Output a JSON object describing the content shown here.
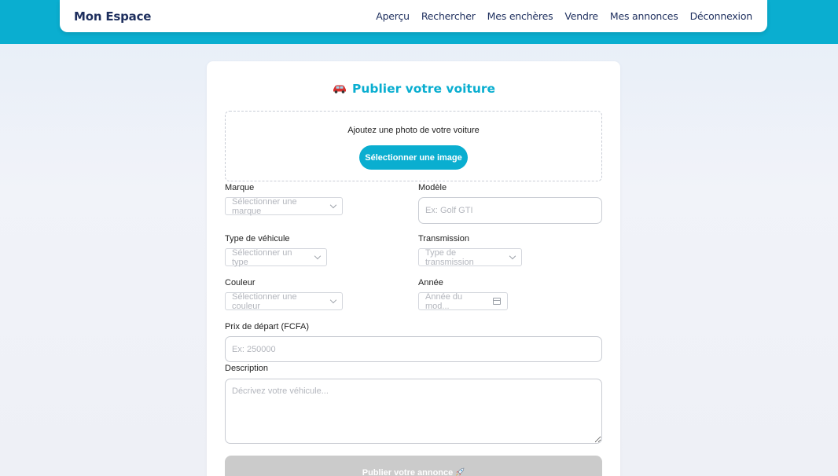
{
  "nav": {
    "brand": "Mon Espace",
    "links": [
      "Aperçu",
      "Rechercher",
      "Mes enchères",
      "Vendre",
      "Mes annonces",
      "Déconnexion"
    ]
  },
  "colors": {
    "accent": "#0aaed0",
    "navy": "#1e2f5e",
    "disabled_button": "#cbcbcb"
  },
  "form": {
    "title": "Publier votre voiture",
    "title_icon": "car-icon",
    "upload": {
      "prompt": "Ajoutez une photo de votre voiture",
      "button_label": "Sélectionner une image"
    },
    "marque": {
      "label": "Marque",
      "placeholder": "Sélectionner une marque"
    },
    "modele": {
      "label": "Modèle",
      "placeholder": "Ex: Golf GTI"
    },
    "type_vehicule": {
      "label": "Type de véhicule",
      "placeholder": "Sélectionner un type"
    },
    "transmission": {
      "label": "Transmission",
      "placeholder": "Type de transmission"
    },
    "couleur": {
      "label": "Couleur",
      "placeholder": "Sélectionner une couleur"
    },
    "annee": {
      "label": "Année",
      "placeholder": "Année du mod...",
      "icon": "calendar-icon"
    },
    "prix": {
      "label": "Prix de départ (FCFA)",
      "placeholder": "Ex: 250000"
    },
    "description": {
      "label": "Description",
      "placeholder": "Décrivez votre véhicule..."
    },
    "submit_label": "Publier votre annonce",
    "submit_icon": "rocket-icon"
  }
}
